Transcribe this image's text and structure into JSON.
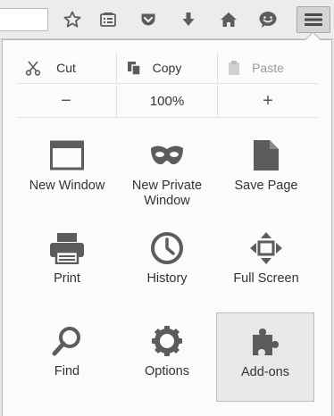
{
  "toolbar": {
    "icons": [
      "bookmark-star-icon",
      "reading-list-icon",
      "pocket-icon",
      "download-icon",
      "home-icon",
      "chat-icon"
    ],
    "menu_icon": "hamburger-menu-icon"
  },
  "edit": {
    "cut": {
      "label": "Cut",
      "icon": "scissors-icon"
    },
    "copy": {
      "label": "Copy",
      "icon": "copy-icon"
    },
    "paste": {
      "label": "Paste",
      "icon": "paste-icon",
      "disabled": true
    }
  },
  "zoom": {
    "minus": "−",
    "level": "100%",
    "plus": "+"
  },
  "grid": [
    {
      "label": "New Window",
      "icon": "window-icon"
    },
    {
      "label": "New Private\nWindow",
      "icon": "mask-icon"
    },
    {
      "label": "Save Page",
      "icon": "page-icon"
    },
    {
      "label": "Print",
      "icon": "printer-icon"
    },
    {
      "label": "History",
      "icon": "clock-icon"
    },
    {
      "label": "Full Screen",
      "icon": "fullscreen-icon"
    },
    {
      "label": "Find",
      "icon": "magnifier-icon"
    },
    {
      "label": "Options",
      "icon": "gear-icon"
    },
    {
      "label": "Add-ons",
      "icon": "puzzle-icon",
      "active": true
    }
  ],
  "colors": {
    "icon": "#5c5c5c",
    "active_bg": "#e8e8e8"
  }
}
